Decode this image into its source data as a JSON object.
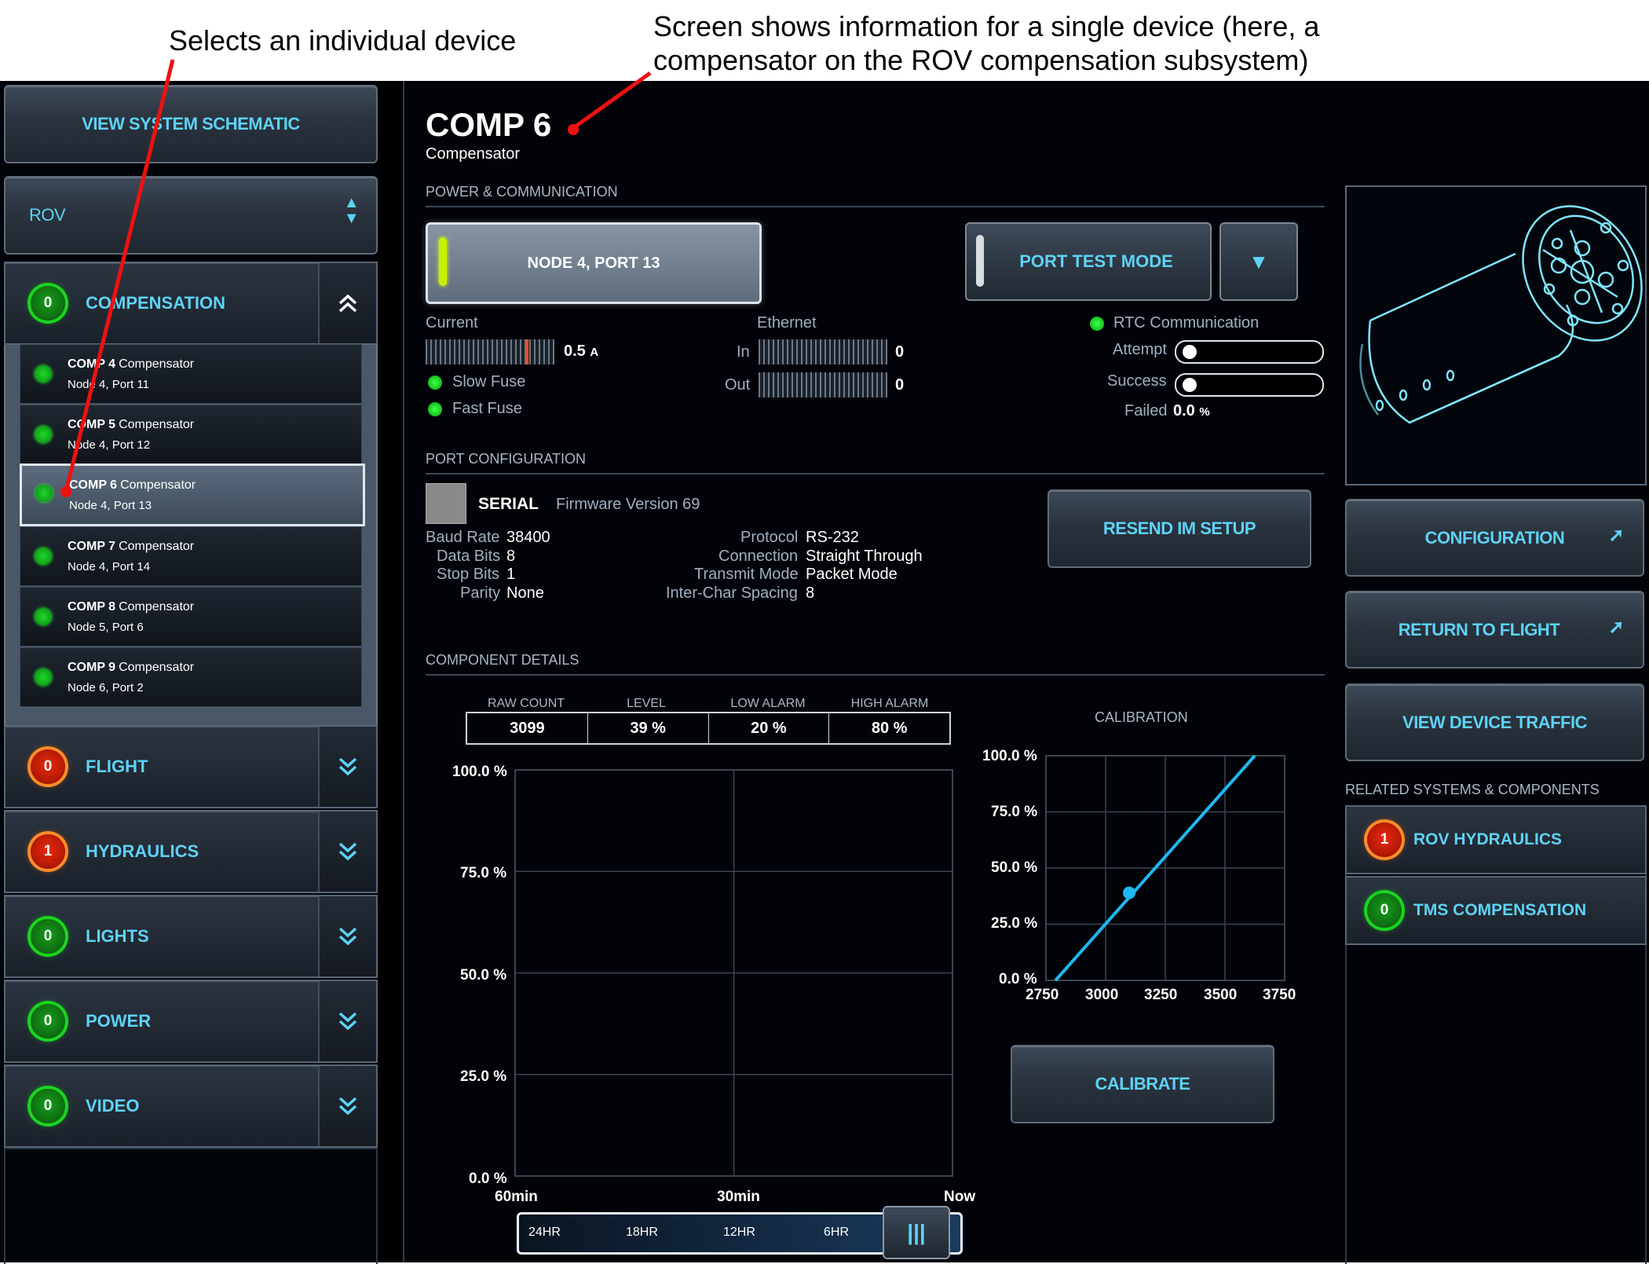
{
  "annotations": {
    "left": "Selects an individual device",
    "right_line1": "Screen shows information for a single device (here, a",
    "right_line2": "compensator on the ROV compensation subsystem)"
  },
  "sidebar": {
    "view_schematic": "VIEW SYSTEM SCHEMATIC",
    "system_select": "ROV",
    "groups": [
      {
        "count": "0",
        "label": "COMPENSATION",
        "status": "green",
        "expanded": true
      },
      {
        "count": "0",
        "label": "FLIGHT",
        "status": "red"
      },
      {
        "count": "1",
        "label": "HYDRAULICS",
        "status": "red"
      },
      {
        "count": "0",
        "label": "LIGHTS",
        "status": "green"
      },
      {
        "count": "0",
        "label": "POWER",
        "status": "green"
      },
      {
        "count": "0",
        "label": "VIDEO",
        "status": "green"
      }
    ],
    "devices": [
      {
        "name": "COMP 4",
        "type": "Compensator",
        "loc": "Node 4, Port 11"
      },
      {
        "name": "COMP 5",
        "type": "Compensator",
        "loc": "Node 4, Port 12"
      },
      {
        "name": "COMP 6",
        "type": "Compensator",
        "loc": "Node 4, Port 13",
        "selected": true
      },
      {
        "name": "COMP 7",
        "type": "Compensator",
        "loc": "Node 4, Port 14"
      },
      {
        "name": "COMP 8",
        "type": "Compensator",
        "loc": "Node 5, Port 6"
      },
      {
        "name": "COMP 9",
        "type": "Compensator",
        "loc": "Node 6, Port 2"
      }
    ]
  },
  "device": {
    "title": "COMP 6",
    "subtitle": "Compensator"
  },
  "power": {
    "section": "POWER & COMMUNICATION",
    "node_port": "NODE 4, PORT 13",
    "port_mode": "PORT TEST MODE",
    "current_label": "Current",
    "current_value": "0.5",
    "current_unit": "A",
    "slow_fuse": "Slow Fuse",
    "fast_fuse": "Fast Fuse",
    "ethernet_label": "Ethernet",
    "in_label": "In",
    "in_value": "0",
    "out_label": "Out",
    "out_value": "0",
    "rtc_label": "RTC Communication",
    "attempt_label": "Attempt",
    "success_label": "Success",
    "failed_label": "Failed",
    "failed_value": "0.0",
    "failed_unit": "%"
  },
  "port_config": {
    "section": "PORT CONFIGURATION",
    "type": "SERIAL",
    "firmware": "Firmware Version 69",
    "resend": "RESEND IM SETUP",
    "baud_label": "Baud Rate",
    "baud": "38400",
    "data_label": "Data Bits",
    "data": "8",
    "stop_label": "Stop Bits",
    "stop": "1",
    "parity_label": "Parity",
    "parity": "None",
    "protocol_label": "Protocol",
    "protocol": "RS-232",
    "connection_label": "Connection",
    "connection": "Straight Through",
    "transmit_label": "Transmit Mode",
    "transmit": "Packet Mode",
    "interchar_label": "Inter-Char Spacing",
    "interchar": "8"
  },
  "component": {
    "section": "COMPONENT DETAILS",
    "headers": [
      "RAW COUNT",
      "LEVEL",
      "LOW ALARM",
      "HIGH ALARM"
    ],
    "values": [
      "3099",
      "39 %",
      "20 %",
      "80 %"
    ],
    "calibration_title": "CALIBRATION",
    "calibrate": "CALIBRATE",
    "time_options": [
      "24HR",
      "18HR",
      "12HR",
      "6HR"
    ],
    "slider_handle": "|||"
  },
  "chart_data": [
    {
      "type": "line",
      "title": "",
      "y_ticks": [
        "100.0 %",
        "75.0 %",
        "50.0 %",
        "25.0 %",
        "0.0 %"
      ],
      "x_ticks": [
        "60min",
        "30min",
        "Now"
      ],
      "ylim": [
        0,
        100
      ],
      "series": [],
      "grid": true
    },
    {
      "type": "line",
      "title": "CALIBRATION",
      "y_ticks": [
        "100.0 %",
        "75.0 %",
        "50.0 %",
        "25.0 %",
        "0.0 %"
      ],
      "x_ticks": [
        "2750",
        "3000",
        "3250",
        "3500",
        "3750"
      ],
      "xlim": [
        2750,
        3750
      ],
      "ylim": [
        0,
        100
      ],
      "series": [
        {
          "x": [
            2790,
            3625
          ],
          "y": [
            0,
            100
          ]
        }
      ],
      "marker": {
        "x": 3099,
        "y": 39
      },
      "color": "#1fb8f0",
      "grid": true
    }
  ],
  "right": {
    "configuration": "CONFIGURATION",
    "return_flight": "RETURN TO FLIGHT",
    "view_traffic": "VIEW DEVICE TRAFFIC",
    "related_title": "RELATED SYSTEMS & COMPONENTS",
    "related": [
      {
        "count": "1",
        "label": "ROV HYDRAULICS",
        "status": "red"
      },
      {
        "count": "0",
        "label": "TMS COMPENSATION",
        "status": "green"
      }
    ]
  },
  "colors": {
    "accent": "#5ed2f5",
    "green": "#1bd420",
    "red": "#e82a10",
    "line": "#1fb8f0"
  }
}
